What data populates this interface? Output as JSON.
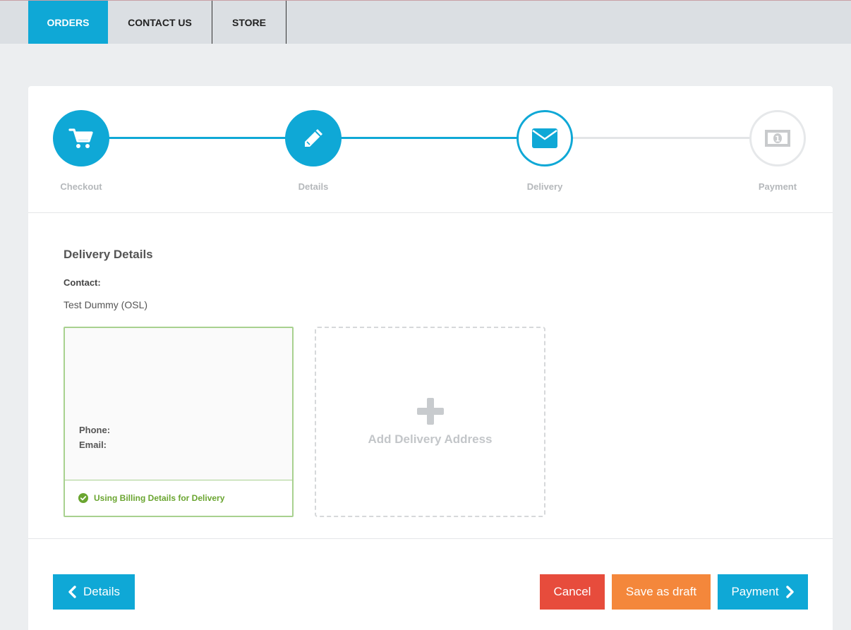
{
  "nav": {
    "tabs": [
      {
        "label": "ORDERS",
        "active": true
      },
      {
        "label": "CONTACT US",
        "active": false
      },
      {
        "label": "STORE",
        "active": false
      }
    ]
  },
  "stepper": {
    "steps": [
      {
        "label": "Checkout",
        "icon": "cart-icon",
        "state": "done"
      },
      {
        "label": "Details",
        "icon": "pencil-icon",
        "state": "done"
      },
      {
        "label": "Delivery",
        "icon": "envelope-icon",
        "state": "current"
      },
      {
        "label": "Payment",
        "icon": "money-icon",
        "state": "todo"
      }
    ]
  },
  "delivery": {
    "title": "Delivery Details",
    "contact_label": "Contact:",
    "contact_value": "Test Dummy (OSL)",
    "address_card": {
      "phone_label": "Phone:",
      "email_label": "Email:",
      "status": "Using Billing Details for Delivery"
    },
    "add_address_label": "Add Delivery Address"
  },
  "actions": {
    "back_label": "Details",
    "cancel_label": "Cancel",
    "draft_label": "Save as draft",
    "next_label": "Payment"
  },
  "colors": {
    "accent": "#0fa8d6",
    "cancel": "#e74c3c",
    "draft": "#f4873b",
    "success": "#6aa530"
  }
}
